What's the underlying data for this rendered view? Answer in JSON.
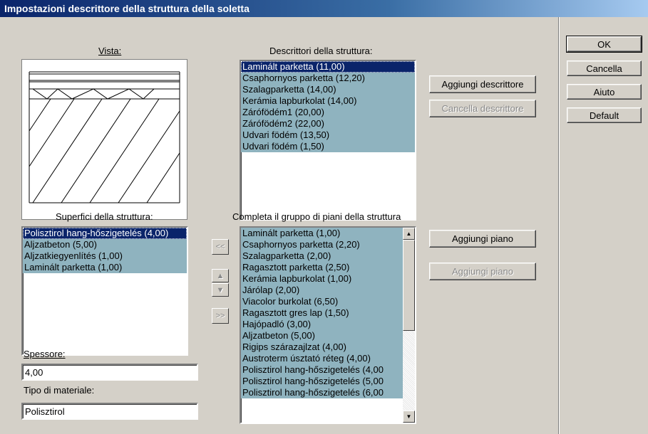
{
  "window": {
    "title": "Impostazioni descrittore della struttura della soletta"
  },
  "buttons": {
    "ok": "OK",
    "cancel": "Cancella",
    "help": "Aiuto",
    "default": "Default",
    "add_descriptor": "Aggiungi descrittore",
    "delete_descriptor": "Cancella descrittore",
    "add_floor": "Aggiungi piano",
    "add_floor_disabled": "Aggiungi piano",
    "move_left": "<<",
    "move_up": "▲",
    "move_down": "▼",
    "move_right": ">>"
  },
  "view": {
    "label": "Vista:"
  },
  "descriptors": {
    "label": "Descrittori della struttura:",
    "items": [
      "Laminált parketta (11,00)",
      "Csaphornyos parketta (12,20)",
      "Szalagparketta (14,00)",
      "Kerámia lapburkolat (14,00)",
      "Zárófödém1 (20,00)",
      "Zárófödém2 (22,00)",
      "Udvari födém (13,50)",
      "Udvari födém (1,50)"
    ]
  },
  "surfaces": {
    "label": "Superfici della struttura:",
    "items": [
      "Polisztirol hang-hőszigetelés (4,00)",
      "Aljzatbeton (5,00)",
      "Aljzatkiegyenlítés (1,00)",
      "Laminált parketta (1,00)"
    ]
  },
  "floors": {
    "label": "Completa il gruppo di piani della struttura",
    "items": [
      "Laminált parketta (1,00)",
      "Csaphornyos parketta (2,20)",
      "Szalagparketta (2,00)",
      "Ragasztott parketta (2,50)",
      "Kerámia lapburkolat (1,00)",
      "Járólap (2,00)",
      "Viacolor burkolat (6,50)",
      "Ragasztott gres lap (1,50)",
      "Hajópadló (3,00)",
      "Aljzatbeton (5,00)",
      "Rigips szárazajlzat (4,00)",
      "Austroterm úsztató réteg (4,00)",
      "Polisztirol hang-hőszigetelés (4,00",
      "Polisztirol hang-hőszigetelés (5,00",
      "Polisztirol hang-hőszigetelés (6,00"
    ]
  },
  "thickness": {
    "label": "Spessore:",
    "value": "4,00"
  },
  "material": {
    "label": "Tipo di materiale:",
    "value": "Polisztirol"
  },
  "colors": {
    "list_item_bg": "#8fb3bf",
    "selected_bg": "#0a246a",
    "dialog_bg": "#d4d0c8"
  }
}
